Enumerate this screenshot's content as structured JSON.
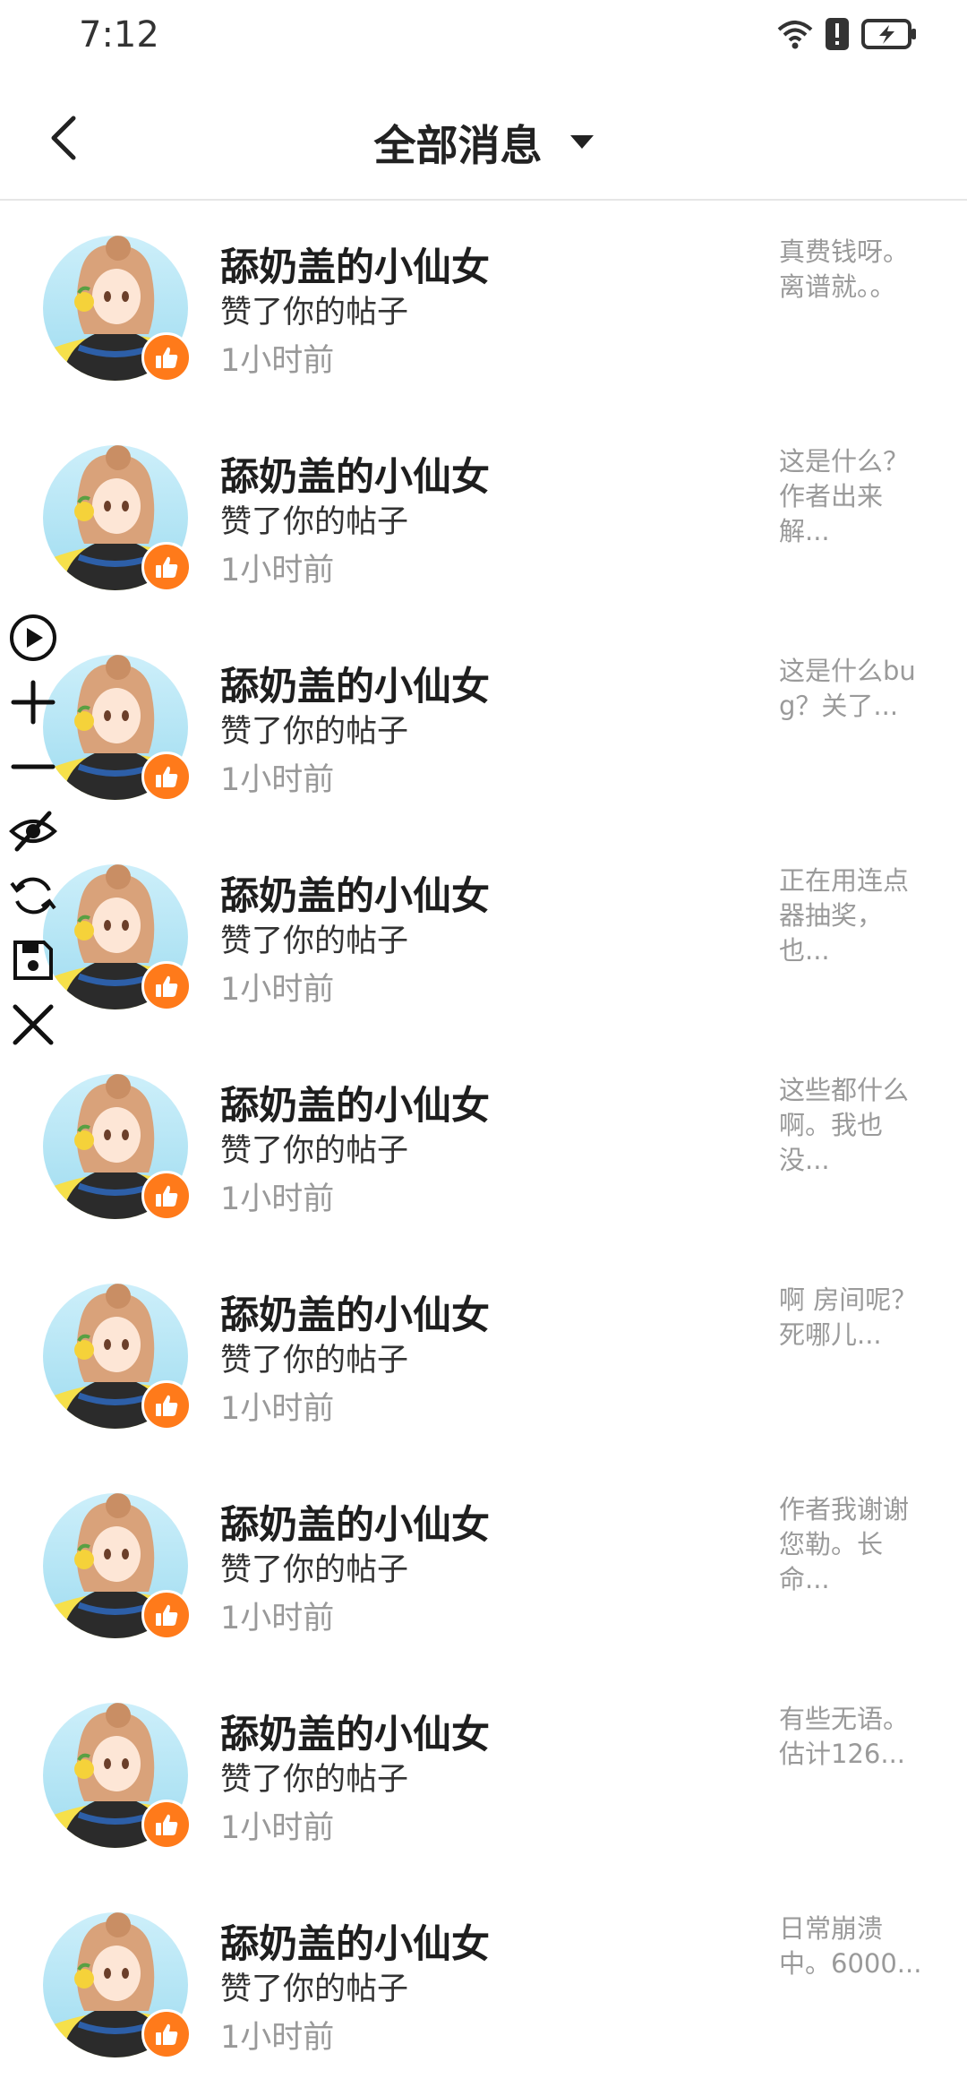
{
  "status_bar": {
    "time": "7:12",
    "icons": [
      "wifi-icon",
      "alert-icon",
      "battery-charging-icon"
    ]
  },
  "header": {
    "back_icon": "chevron-left-icon",
    "title": "全部消息",
    "dropdown_icon": "caret-down-icon"
  },
  "colors": {
    "accent": "#ff7a1a",
    "muted": "#9a9a9a"
  },
  "messages": [
    {
      "name": "舔奶盖的小仙女",
      "action": "赞了你的帖子",
      "time": "1小时前",
      "preview": "真费钱呀。离谱就。。"
    },
    {
      "name": "舔奶盖的小仙女",
      "action": "赞了你的帖子",
      "time": "1小时前",
      "preview": "这是什么？作者出来解..."
    },
    {
      "name": "舔奶盖的小仙女",
      "action": "赞了你的帖子",
      "time": "1小时前",
      "preview": "这是什么bug？关了..."
    },
    {
      "name": "舔奶盖的小仙女",
      "action": "赞了你的帖子",
      "time": "1小时前",
      "preview": "正在用连点器抽奖，也..."
    },
    {
      "name": "舔奶盖的小仙女",
      "action": "赞了你的帖子",
      "time": "1小时前",
      "preview": "这些都什么啊。我也没..."
    },
    {
      "name": "舔奶盖的小仙女",
      "action": "赞了你的帖子",
      "time": "1小时前",
      "preview": "啊 房间呢？死哪儿..."
    },
    {
      "name": "舔奶盖的小仙女",
      "action": "赞了你的帖子",
      "time": "1小时前",
      "preview": "作者我谢谢您勒。长命..."
    },
    {
      "name": "舔奶盖的小仙女",
      "action": "赞了你的帖子",
      "time": "1小时前",
      "preview": "有些无语。估计126..."
    },
    {
      "name": "舔奶盖的小仙女",
      "action": "赞了你的帖子",
      "time": "1小时前",
      "preview": "日常崩溃中。6000..."
    }
  ],
  "floating_tools": [
    "play-icon",
    "plus-icon",
    "minus-icon",
    "eye-off-icon",
    "refresh-icon",
    "save-icon",
    "close-icon"
  ]
}
